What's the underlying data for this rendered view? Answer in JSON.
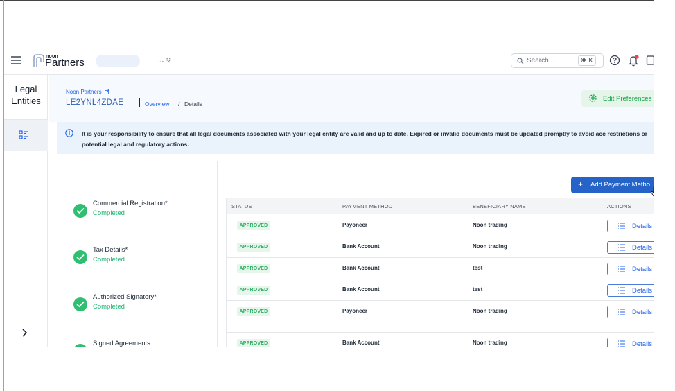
{
  "topbar": {
    "brand_small": "noon",
    "brand": "Partners",
    "partner_ellipsis": "... ≎",
    "search_placeholder": "Search...",
    "search_shortcut": "⌘ K"
  },
  "sidebar": {
    "title": "Legal Entities"
  },
  "header": {
    "breadcrumb_top": "Noon Partners",
    "entity_id": "LE2YNL4ZDAE",
    "overview": "Overview",
    "separator": "/",
    "details": "Details",
    "edit_preferences": "Edit Preferences"
  },
  "notice": {
    "text": "It is your responsibility to ensure that all legal documents associated with your legal entity are valid and up to date. Expired or invalid documents must be updated promptly to avoid acc restrictions or potential legal and regulatory actions."
  },
  "steps": [
    {
      "title": "Commercial Registration*",
      "status": "Completed"
    },
    {
      "title": "Tax Details*",
      "status": "Completed"
    },
    {
      "title": "Authorized Signatory*",
      "status": "Completed"
    },
    {
      "title": "Signed Agreements",
      "status": ""
    }
  ],
  "add_button": {
    "plus": "+",
    "label": "Add Payment Metho"
  },
  "table": {
    "headers": [
      "STATUS",
      "PAYMENT METHOD",
      "BENEFICIARY NAME",
      "ACTIONS"
    ],
    "rows": [
      {
        "status": "APPROVED",
        "method": "Payoneer",
        "beneficiary": "Noon trading",
        "action": "Details"
      },
      {
        "status": "APPROVED",
        "method": "Bank Account",
        "beneficiary": "Noon trading",
        "action": "Details"
      },
      {
        "status": "APPROVED",
        "method": "Bank Account",
        "beneficiary": "test",
        "action": "Details"
      },
      {
        "status": "APPROVED",
        "method": "Bank Account",
        "beneficiary": "test",
        "action": "Details"
      },
      {
        "status": "APPROVED",
        "method": "Payoneer",
        "beneficiary": "Noon trading",
        "action": "Details"
      },
      {
        "status": "APPROVED",
        "method": "Bank Account",
        "beneficiary": "Noon trading",
        "action": "Details"
      }
    ]
  },
  "colors": {
    "accent": "#2563c9",
    "success": "#2fbf71",
    "notice_bg": "#eaf2fc"
  }
}
